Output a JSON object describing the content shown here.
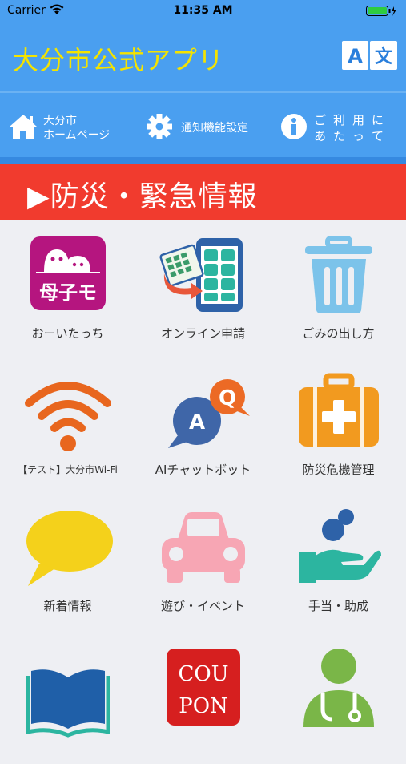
{
  "status": {
    "carrier": "Carrier",
    "time": "11:35 AM"
  },
  "app": {
    "title": "大分市公式アプリ",
    "translate_a": "A",
    "translate_b": "文"
  },
  "nav": {
    "home_line1": "大分市",
    "home_line2": "ホームページ",
    "notify": "通知機能設定",
    "info_chars": [
      "ご",
      "利",
      "用",
      "に",
      "あ",
      "た",
      "っ",
      "て"
    ]
  },
  "emergency": {
    "label": "▶防災・緊急情報"
  },
  "grid": [
    {
      "label": "おーいたっち",
      "icon": "ouitatchi-app-icon",
      "badge": "母子モ"
    },
    {
      "label": "オンライン申請",
      "icon": "online-application-icon"
    },
    {
      "label": "ごみの出し方",
      "icon": "trash-icon"
    },
    {
      "label": "【テスト】大分市Wi-Fi",
      "icon": "wifi-icon"
    },
    {
      "label": "AIチャットボット",
      "icon": "chatbot-qa-icon",
      "q": "Q",
      "a": "A"
    },
    {
      "label": "防災危機管理",
      "icon": "first-aid-kit-icon"
    },
    {
      "label": "新着情報",
      "icon": "speech-bubble-icon"
    },
    {
      "label": "遊び・イベント",
      "icon": "car-icon"
    },
    {
      "label": "手当・助成",
      "icon": "hand-support-icon"
    },
    {
      "label": "",
      "icon": "book-icon"
    },
    {
      "label": "",
      "icon": "coupon-icon",
      "coupon1": "COU",
      "coupon2": "PON"
    },
    {
      "label": "",
      "icon": "doctor-icon"
    }
  ],
  "colors": {
    "header": "#4a9ff0",
    "title": "#f4e300",
    "emergency": "#f13b2e",
    "background": "#eeeff3"
  }
}
